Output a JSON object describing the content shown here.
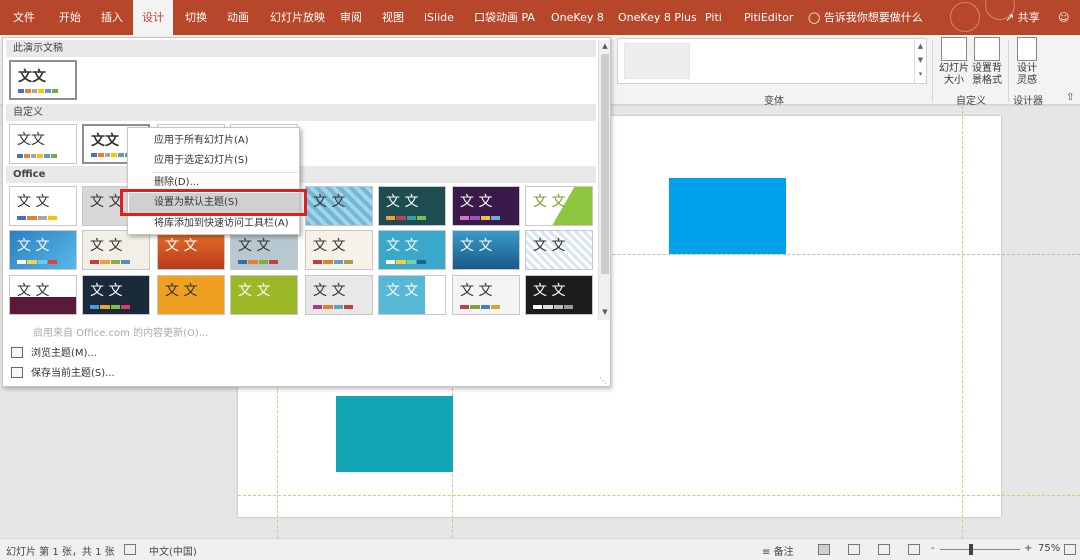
{
  "ribbon_tabs": [
    {
      "label": "文件",
      "active": false
    },
    {
      "label": "开始",
      "active": false
    },
    {
      "label": "插入",
      "active": false
    },
    {
      "label": "设计",
      "active": true
    },
    {
      "label": "切换",
      "active": false
    },
    {
      "label": "动画",
      "active": false
    },
    {
      "label": "幻灯片放映",
      "active": false
    },
    {
      "label": "审阅",
      "active": false
    },
    {
      "label": "视图",
      "active": false
    },
    {
      "label": "iSlide",
      "active": false
    },
    {
      "label": "口袋动画 PA",
      "active": false
    },
    {
      "label": "OneKey 8",
      "active": false
    },
    {
      "label": "OneKey 8 Plus",
      "active": false
    },
    {
      "label": "Piti",
      "active": false
    },
    {
      "label": "PitiEditor",
      "active": false
    }
  ],
  "tell_me": "告诉我你想要做什么",
  "share": "共享",
  "ribbon": {
    "variants_label": "变体",
    "slide_size_label_1": "幻灯片",
    "slide_size_label_2": "大小",
    "format_bg_label_1": "设置背",
    "format_bg_label_2": "景格式",
    "customize_label": "自定义",
    "designer_label_1": "设计",
    "designer_label_2": "灵感",
    "designer_group_label": "设计器"
  },
  "theme_panel": {
    "section_this_doc": "此演示文稿",
    "section_custom": "自定义",
    "section_office": "Office",
    "thumb_text": "文文",
    "thumb_text_alt": "文 文",
    "enable_content": "启用来自 Office.com 的内容更新(O)...",
    "browse_themes": "浏览主题(M)...",
    "save_theme": "保存当前主题(S)..."
  },
  "context_menu": {
    "items": [
      "应用于所有幻灯片(A)",
      "应用于选定幻灯片(S)",
      "删除(D)...",
      "设置为默认主题(S)",
      "将库添加到快速访问工具栏(A)"
    ],
    "highlighted_index": 3
  },
  "status_bar": {
    "slide_info": "幻灯片 第 1 张，共 1 张",
    "language": "中文(中国)",
    "notes": "备注",
    "zoom": "75%",
    "zoom_minus": "-",
    "zoom_plus": "+"
  },
  "colors": {
    "accent": "#b7472a",
    "shape_blue": "#00a2ed",
    "shape_teal": "#12a5b4",
    "highlight_outline": "#e02020"
  }
}
